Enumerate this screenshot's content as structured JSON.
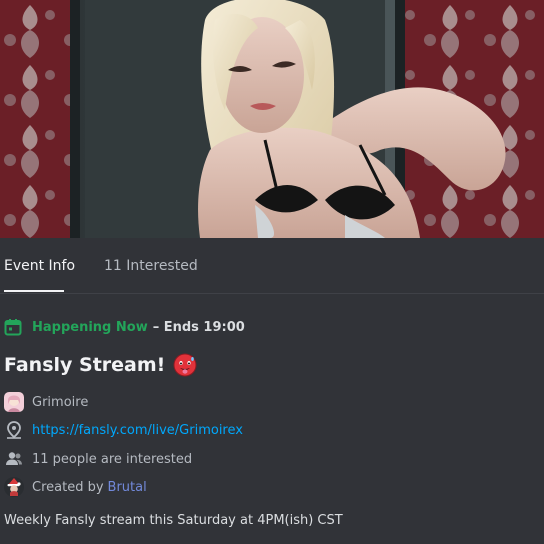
{
  "tabs": [
    {
      "label": "Event Info"
    },
    {
      "label": "11 Interested"
    }
  ],
  "status": {
    "icon": "calendar-icon",
    "happening": "Happening Now",
    "ends": "– Ends 19:00"
  },
  "event": {
    "title": "Fansly Stream!",
    "title_emoji": "hot-face-emoji",
    "host": "Grimoire",
    "location_url": "https://fansly.com/live/Grimoirex",
    "interested": "11 people are interested",
    "created_by_label": "Created by",
    "creator": "Brutal",
    "description": "Weekly Fansly stream this Saturday at 4PM(ish) CST"
  },
  "colors": {
    "background": "#313338",
    "happening_green": "#23a55a",
    "link_blue": "#00a8fc",
    "creator_purple": "#7289da"
  }
}
